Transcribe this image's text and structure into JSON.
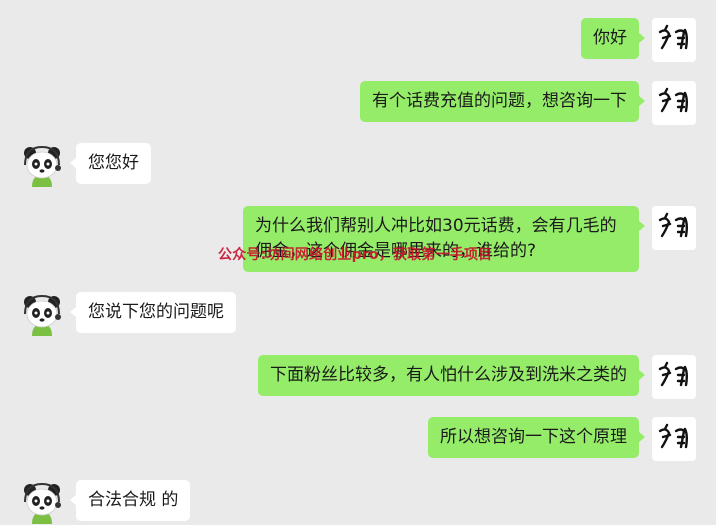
{
  "messages": [
    {
      "sender": "me",
      "text": "你好"
    },
    {
      "sender": "me",
      "text": "有个话费充值的问题，想咨询一下"
    },
    {
      "sender": "them",
      "text": "您您好"
    },
    {
      "sender": "me",
      "text": "为什么我们帮别人冲比如30元话费，会有几毛的佣金，这个佣金是哪里来的，谁给的?"
    },
    {
      "sender": "them",
      "text": "您说下您的问题呢"
    },
    {
      "sender": "me",
      "text": "下面粉丝比较多，有人怕什么涉及到洗米之类的"
    },
    {
      "sender": "me",
      "text": "所以想咨询一下这个原理"
    },
    {
      "sender": "them",
      "text": "合法合规 的"
    }
  ],
  "watermark": {
    "text": "公众号:坊间网络创业pro，获取第一手项目",
    "color": "#c8102e"
  },
  "colors": {
    "background": "#eaeaea",
    "my_bubble": "#95ec69",
    "their_bubble": "#ffffff"
  },
  "avatars": {
    "me": "calligraphy-avatar-icon",
    "them": "panda-avatar-icon"
  }
}
